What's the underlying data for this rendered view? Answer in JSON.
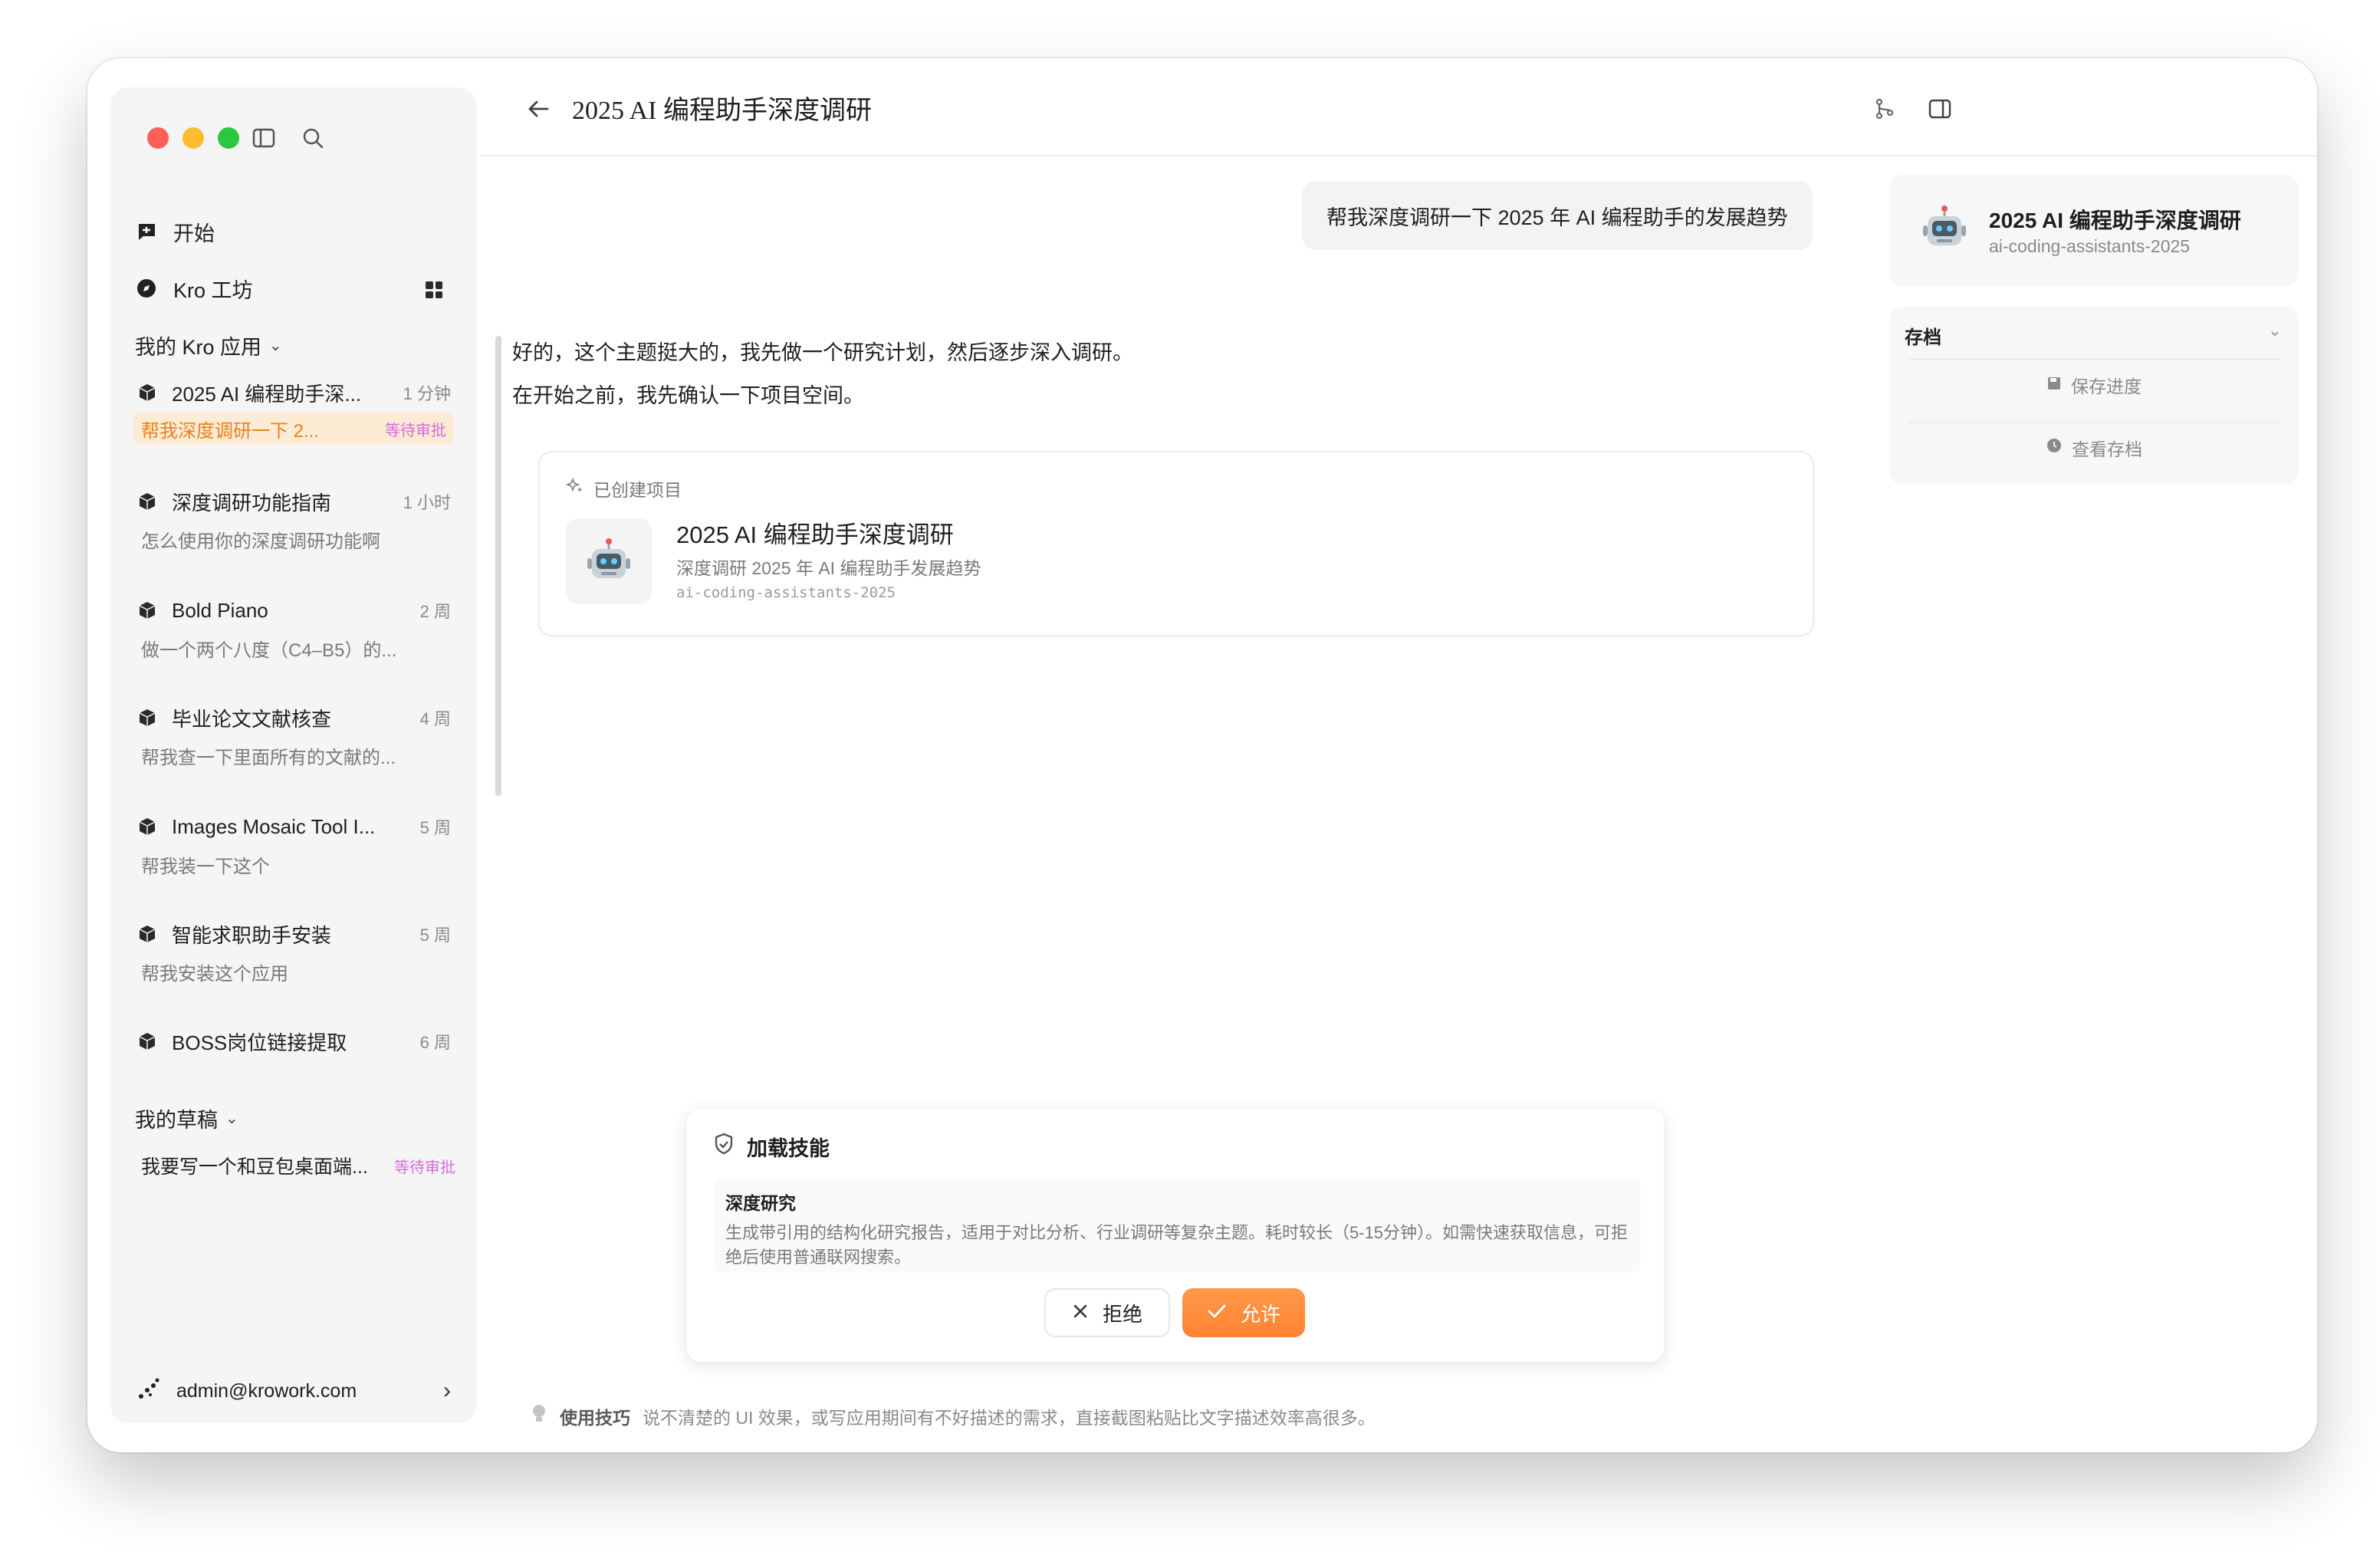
{
  "sidebar": {
    "nav": {
      "start": "开始",
      "workshop": "Kro 工坊"
    },
    "apps_section": "我的 Kro 应用",
    "apps": [
      {
        "title": "2025 AI 编程助手深...",
        "time": "1 分钟",
        "sub": "帮我深度调研一下 2...",
        "status": "等待审批"
      },
      {
        "title": "深度调研功能指南",
        "time": "1 小时",
        "sub": "怎么使用你的深度调研功能啊"
      },
      {
        "title": "Bold Piano",
        "time": "2 周",
        "sub": "做一个两个八度（C4–B5）的..."
      },
      {
        "title": "毕业论文文献核查",
        "time": "4 周",
        "sub": "帮我查一下里面所有的文献的..."
      },
      {
        "title": "Images Mosaic Tool I...",
        "time": "5 周",
        "sub": "帮我装一下这个"
      },
      {
        "title": "智能求职助手安装",
        "time": "5 周",
        "sub": "帮我安装这个应用"
      },
      {
        "title": "BOSS岗位链接提取",
        "time": "6 周"
      }
    ],
    "drafts_section": "我的草稿",
    "draft": {
      "text": "我要写一个和豆包桌面端...",
      "status": "等待审批"
    },
    "user": "admin@krowork.com"
  },
  "header": {
    "title": "2025 AI 编程助手深度调研"
  },
  "chat": {
    "user_message": "帮我深度调研一下 2025 年 AI 编程助手的发展趋势",
    "assistant_line1": "好的，这个主题挺大的，我先做一个研究计划，然后逐步深入调研。",
    "assistant_line2": "在开始之前，我先确认一下项目空间。",
    "project_card": {
      "label": "已创建项目",
      "name": "2025 AI 编程助手深度调研",
      "desc": "深度调研 2025 年 AI 编程助手发展趋势",
      "slug": "ai-coding-assistants-2025",
      "avatar_icon": "robot-icon"
    }
  },
  "right_panel": {
    "name": "2025 AI 编程助手深度调研",
    "slug": "ai-coding-assistants-2025",
    "archive_title": "存档",
    "save_label": "保存进度",
    "view_label": "查看存档"
  },
  "skill": {
    "title": "加载技能",
    "name": "深度研究",
    "desc": "生成带引用的结构化研究报告，适用于对比分析、行业调研等复杂主题。耗时较长（5-15分钟）。如需快速获取信息，可拒绝后使用普通联网搜索。",
    "reject": "拒绝",
    "allow": "允许"
  },
  "tip": {
    "label": "使用技巧",
    "text": "说不清楚的 UI 效果，或写应用期间有不好描述的需求，直接截图粘贴比文字描述效率高很多。"
  },
  "colors": {
    "accent": "#ff8a3d",
    "pending": "#d66bd9",
    "active_bg": "#fdebd6"
  }
}
